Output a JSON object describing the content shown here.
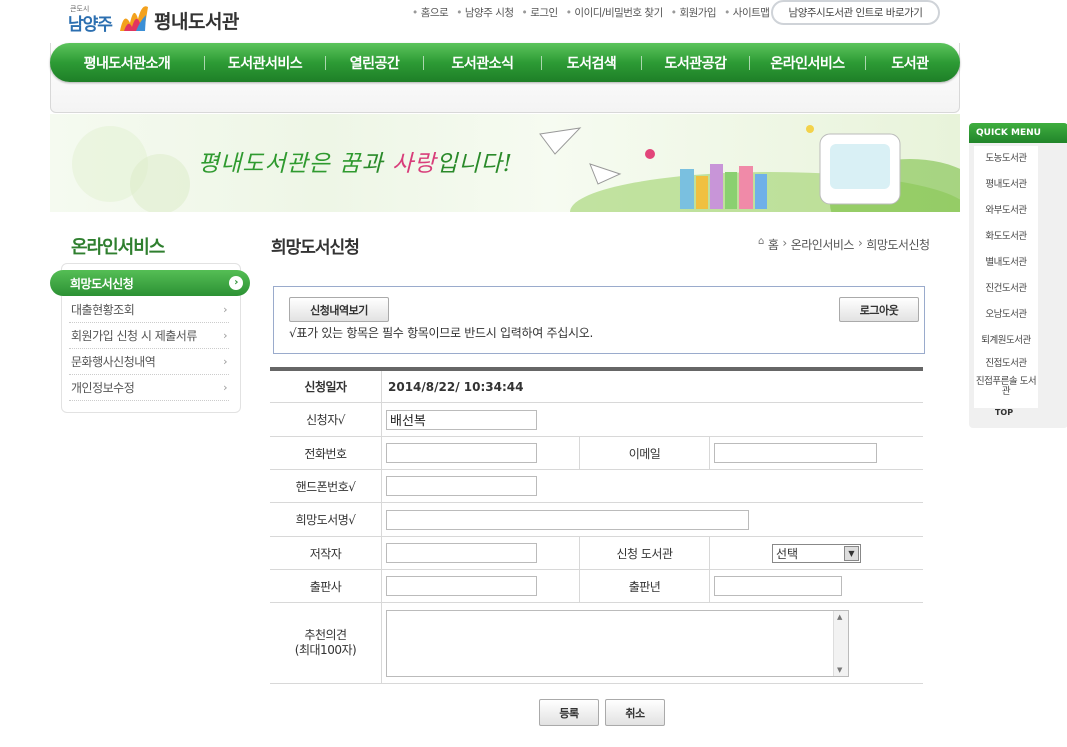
{
  "header": {
    "logo_sub": "큰도시",
    "logo_city": "남양주",
    "logo_name": "평내도서관",
    "top_links": [
      "홈으로",
      "남양주 시청",
      "로그인",
      "이이디/비밀번호 찾기",
      "회원가입",
      "사이트맵"
    ],
    "intro_button": "남양주시도서관 인트로 바로가기"
  },
  "gnb": [
    "평내도서관소개",
    "도서관서비스",
    "열린공간",
    "도서관소식",
    "도서검색",
    "도서관공감",
    "온라인서비스",
    "도서관"
  ],
  "banner": {
    "slogan_part1": "평내도서관은 ",
    "slogan_part2": "꿈",
    "slogan_part3": "과 ",
    "slogan_part4": "사랑",
    "slogan_part5": "입니다!"
  },
  "quick_menu": {
    "title": "QUICK MENU",
    "items": [
      "도농도서관",
      "평내도서관",
      "와부도서관",
      "화도도서관",
      "별내도서관",
      "진건도서관",
      "오남도서관",
      "퇴계원도서관",
      "진접도서관",
      "진접푸른솔 도서관"
    ],
    "top": "TOP"
  },
  "lnb": {
    "title": "온라인서비스",
    "active": "희망도서신청",
    "items": [
      "대출현황조회",
      "회원가입 신청 시 제출서류",
      "문화행사신청내역",
      "개인정보수정"
    ]
  },
  "content": {
    "title": "희망도서신청",
    "breadcrumb": [
      "홈",
      "온라인서비스",
      "희망도서신청"
    ],
    "history_button": "신청내역보기",
    "logout_button": "로그아웃",
    "notice": "√표가 있는 항목은 필수 항목이므로 반드시 입력하여 주십시오."
  },
  "form": {
    "date_label": "신청일자",
    "date_value": "2014/8/22/ 10:34:44",
    "applicant_label": "신청자√",
    "applicant_value": "배선복",
    "phone_label": "전화번호",
    "phone_value": "",
    "email_label": "이메일",
    "email_value": "",
    "mobile_label": "핸드폰번호√",
    "mobile_value": "",
    "book_label": "희망도서명√",
    "book_value": "",
    "author_label": "저작자",
    "author_value": "",
    "library_label": "신청 도서관",
    "library_selected": "선택",
    "publisher_label": "출판사",
    "publisher_value": "",
    "year_label": "출판년",
    "year_value": "",
    "opinion_label_1": "추천의견",
    "opinion_label_2": "(최대100자)",
    "opinion_value": ""
  },
  "buttons": {
    "submit": "등록",
    "cancel": "취소"
  }
}
